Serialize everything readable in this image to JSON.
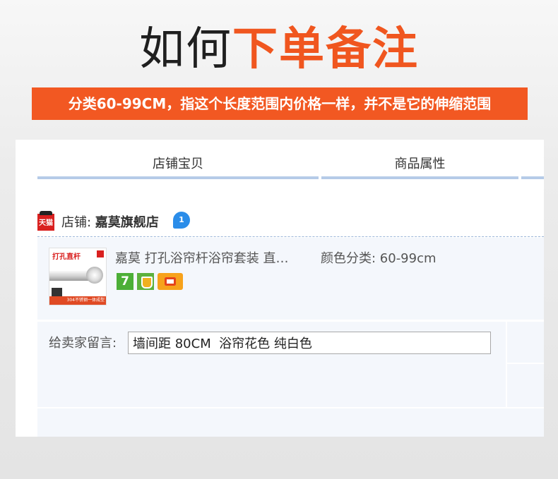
{
  "headline": {
    "part1": "如何",
    "part2": "下单备注"
  },
  "banner": {
    "text": "分类60-99CM，指这个长度范围内价格一样，并不是它的伸缩范围"
  },
  "tabs": [
    {
      "label": "店铺宝贝"
    },
    {
      "label": "商品属性"
    }
  ],
  "shop": {
    "label_prefix": "店铺: ",
    "name": "嘉莫旗舰店",
    "tmall_icon_text": "天猫",
    "wangwang_icon": "wangwang-icon"
  },
  "item": {
    "thumb_title": "打孔直杆",
    "thumb_strip": "304不锈钢一体成型",
    "title": "嘉莫 打孔浴帘杆浴帘套装 直杆...",
    "service_icons": [
      "7",
      "shield-icon",
      "card-icon"
    ],
    "attribute": "颜色分类: 60-99cm"
  },
  "memo": {
    "label": "给卖家留言:",
    "value": "墙间距 80CM  浴帘花色 纯白色"
  },
  "colors": {
    "accent": "#f25822",
    "tab_underline": "#b5cbe8",
    "row_bg": "#f4f7fc"
  }
}
